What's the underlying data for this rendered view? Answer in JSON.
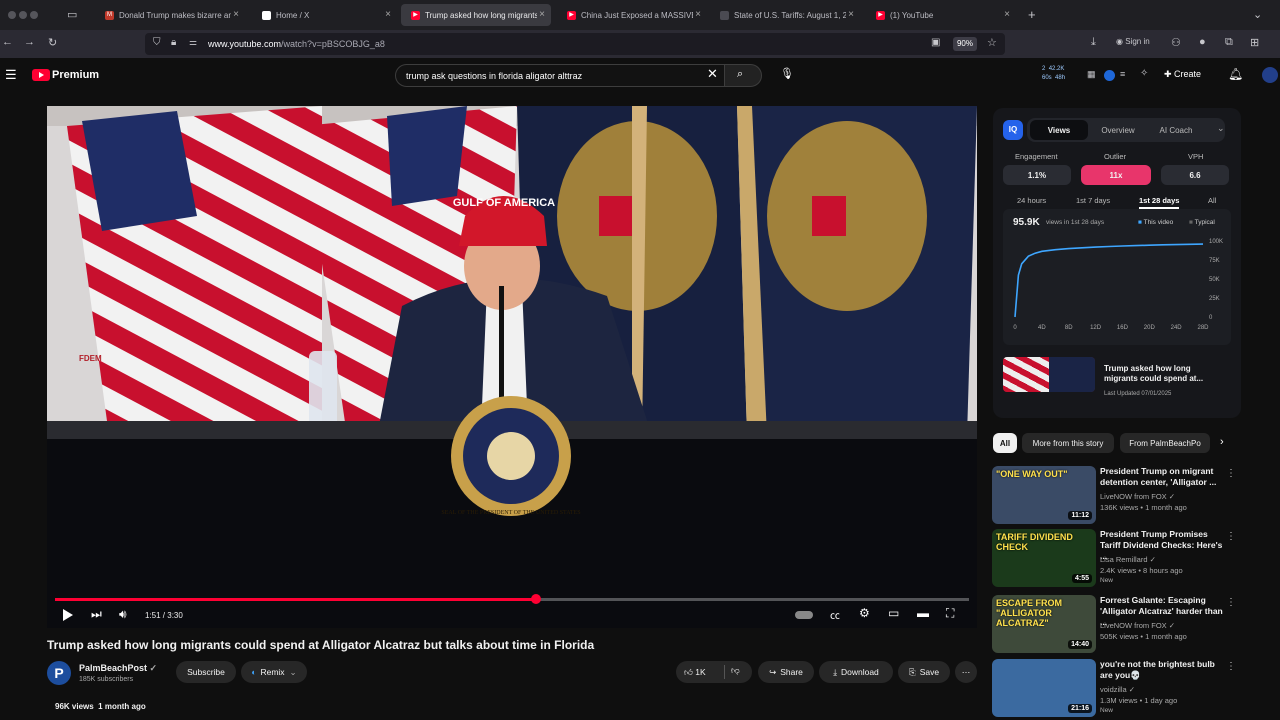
{
  "browser": {
    "tabs": [
      {
        "title": "Donald Trump makes bizarre an",
        "color": "#c0392b",
        "fav": "M"
      },
      {
        "title": "Home / X",
        "color": "#ffffff",
        "fav": "X"
      },
      {
        "title": "Trump asked how long migrants",
        "color": "#ff0033",
        "fav": "▶"
      },
      {
        "title": "China Just Exposed a MASSIVE",
        "color": "#ff0033",
        "fav": "▶"
      },
      {
        "title": "State of U.S. Tariffs: August 1, 2025",
        "color": "#4a4a52",
        "fav": ""
      },
      {
        "title": "(1) YouTube",
        "color": "#ff0033",
        "fav": "▶"
      }
    ],
    "url_host": "www.youtube.com",
    "url_path": "/watch?v=pBSCOBJG_a8",
    "zoom": "90%",
    "signin": "Sign in"
  },
  "header": {
    "logo": "Premium",
    "search_value": "trump ask questions in florida aligator alttraz",
    "create": "Create",
    "vidiq_stats": {
      "a": "2",
      "b": "42.2K",
      "c": "60s",
      "d": "48h"
    }
  },
  "video": {
    "time": "1:51 / 3:30",
    "progress": 0.526,
    "hat_text": "GULF OF AMERICA",
    "seal_text": "SEAL OF THE PRESIDENT OF THE UNITED STATES",
    "wall_text": "FDEM"
  },
  "meta": {
    "title": "Trump asked how long migrants could spend at Alligator Alcatraz but talks about time in Florida",
    "channel": "PalmBeachPost",
    "channel_initial": "P",
    "subscribers": "185K subscribers",
    "subscribe": "Subscribe",
    "remix": "Remix",
    "likes": "1K",
    "share": "Share",
    "download": "Download",
    "save": "Save",
    "views": "96K views",
    "age": "1 month ago"
  },
  "panel": {
    "tabs": [
      "Views",
      "Overview",
      "AI Coach"
    ],
    "metrics": [
      {
        "label": "Engagement",
        "value": "1.1%"
      },
      {
        "label": "Outlier",
        "value": "11x"
      },
      {
        "label": "VPH",
        "value": "6.6"
      }
    ],
    "ranges": [
      "24 hours",
      "1st 7 days",
      "1st 28 days",
      "All"
    ],
    "total": "95.9K",
    "total_caption": "views in 1st 28 days",
    "legend_this": "This video",
    "legend_typical": "Typical",
    "chart_y_ticks": [
      "100K",
      "75K",
      "50K",
      "25K",
      "0"
    ],
    "chart_x_ticks": [
      "0",
      "4D",
      "8D",
      "12D",
      "16D",
      "20D",
      "24D",
      "28D"
    ],
    "mini_title": "Trump asked how long migrants could spend at...",
    "mini_updated": "Last Updated 07/01/2025"
  },
  "chart_data": {
    "type": "line",
    "x": [
      0,
      0.5,
      1,
      2,
      3,
      4,
      6,
      8,
      10,
      12,
      14,
      16,
      18,
      20,
      22,
      24,
      26,
      28
    ],
    "series": [
      {
        "values": [
          0,
          55000,
          70000,
          80000,
          84000,
          86500,
          88500,
          90000,
          91000,
          92000,
          92800,
          93400,
          94000,
          94500,
          95000,
          95300,
          95600,
          95900
        ]
      }
    ],
    "ylim": [
      0,
      100000
    ],
    "xlim": [
      0,
      28
    ]
  },
  "chips": [
    "All",
    "More from this story",
    "From PalmBeachPo"
  ],
  "recommendations": [
    {
      "title": "President Trump on migrant detention center, 'Alligator ...",
      "channel": "LiveNOW from FOX",
      "stats": "136K views • 1 month ago",
      "duration": "11:12",
      "thumb_text": "\"ONE WAY OUT\"",
      "bg": "#3a4b66"
    },
    {
      "title": "President Trump Promises Tariff Dividend Checks: Here's ...",
      "channel": "Lisa Remillard",
      "stats": "2.4K views • 8 hours ago",
      "badge": "New",
      "duration": "4:55",
      "thumb_text": "TARIFF DIVIDEND CHECK",
      "bg": "#1b3a1b"
    },
    {
      "title": "Forrest Galante: Escaping 'Alligator Alcatraz' harder than ...",
      "channel": "LiveNOW from FOX",
      "stats": "505K views • 1 month ago",
      "duration": "14:40",
      "thumb_text": "ESCAPE FROM \"ALLIGATOR ALCATRAZ\"",
      "bg": "#3e4a3a"
    },
    {
      "title": "you're not the brightest bulb are you💀",
      "channel": "voidzilla",
      "stats": "1.3M views • 1 day ago",
      "badge": "New",
      "duration": "21:16",
      "thumb_text": "",
      "bg": "#3b6aa0"
    }
  ]
}
